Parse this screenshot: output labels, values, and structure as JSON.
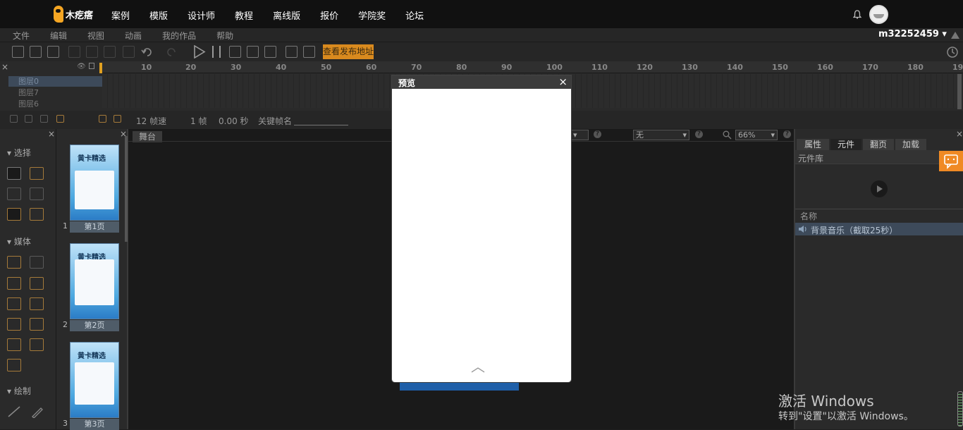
{
  "brand": {
    "name": "木疙瘩"
  },
  "nav": [
    "案例",
    "模版",
    "设计师",
    "教程",
    "离线版",
    "报价",
    "学院奖",
    "论坛"
  ],
  "menu": [
    "文件",
    "编辑",
    "视图",
    "动画",
    "我的作品",
    "帮助"
  ],
  "user": {
    "name": "m32252459 ▾"
  },
  "toolbar": {
    "publish_label": "查看发布地址"
  },
  "timeline": {
    "ticks": [
      "10",
      "20",
      "30",
      "40",
      "50",
      "60",
      "70",
      "80",
      "90",
      "100",
      "110",
      "120",
      "130",
      "140",
      "150",
      "160",
      "170",
      "180",
      "19"
    ],
    "layers": [
      "图层0",
      "图层7",
      "图层6"
    ],
    "fps": "12 帧速",
    "frame": "1 帧",
    "seconds": "0.00 秒",
    "keyframe_label": "关键帧名"
  },
  "tools": {
    "select": "选择",
    "media": "媒体",
    "draw": "绘制"
  },
  "pages": [
    {
      "num": "1",
      "label": "第1页",
      "thumb_title": "黄卡精选"
    },
    {
      "num": "2",
      "label": "第2页",
      "thumb_title": "黄卡精选"
    },
    {
      "num": "3",
      "label": "第3页",
      "thumb_title": "黄卡精选"
    }
  ],
  "stage": {
    "tab": "舞台",
    "select_none": "无",
    "zoom": "66%"
  },
  "right": {
    "tabs": [
      "属性",
      "元件",
      "翻页",
      "加载"
    ],
    "library_title": "元件库",
    "name_header": "名称",
    "item": "背景音乐（截取25秒）"
  },
  "preview": {
    "title": "预览",
    "close": "×",
    "up_arrow": "︿"
  },
  "watermark": {
    "line1": "激活 Windows",
    "line2": "转到\"设置\"以激活 Windows。"
  },
  "colors": {
    "accent": "#f08a24",
    "publish": "#d98a1e",
    "selected_layer": "#3d4a5a"
  }
}
